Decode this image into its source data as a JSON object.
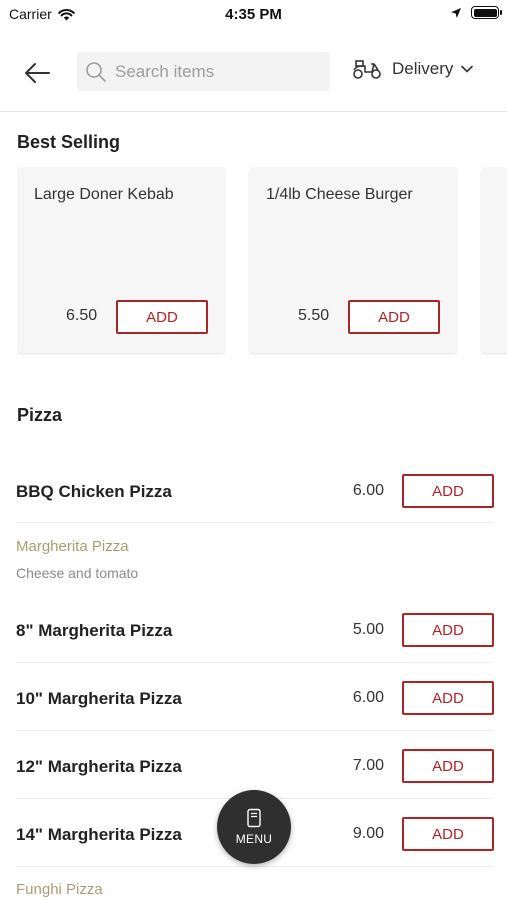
{
  "status_bar": {
    "carrier": "Carrier",
    "time": "4:35 PM"
  },
  "header": {
    "search_placeholder": "Search items",
    "delivery_label": "Delivery"
  },
  "best_selling": {
    "title": "Best Selling",
    "items": [
      {
        "name": "Large Doner Kebab",
        "price": "6.50",
        "add_label": "ADD"
      },
      {
        "name": "1/4lb Cheese Burger",
        "price": "5.50",
        "add_label": "ADD"
      }
    ]
  },
  "pizza": {
    "title": "Pizza",
    "bbq": {
      "name": "BBQ Chicken Pizza",
      "price": "6.00",
      "add_label": "ADD"
    },
    "margherita_group": {
      "title": "Margherita Pizza",
      "subtitle": "Cheese and tomato",
      "items": [
        {
          "name": "8\" Margherita Pizza",
          "price": "5.00",
          "add_label": "ADD"
        },
        {
          "name": "10\" Margherita Pizza",
          "price": "6.00",
          "add_label": "ADD"
        },
        {
          "name": "12\" Margherita Pizza",
          "price": "7.00",
          "add_label": "ADD"
        },
        {
          "name": "14\" Margherita Pizza",
          "price": "9.00",
          "add_label": "ADD"
        }
      ]
    },
    "funghi_group": {
      "title": "Funghi Pizza"
    }
  },
  "menu_button": {
    "label": "MENU"
  },
  "colors": {
    "accent": "#a7262a",
    "group_title": "#a89d72",
    "fab": "#2f2f2f"
  }
}
